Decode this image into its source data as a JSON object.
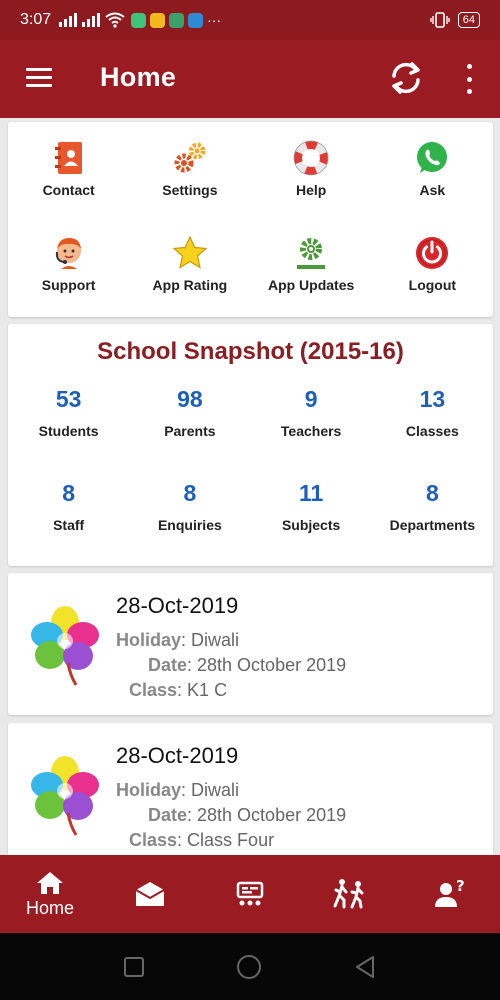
{
  "status_bar": {
    "time": "3:07",
    "battery": "64"
  },
  "app_bar": {
    "title": "Home"
  },
  "menu": {
    "items": [
      {
        "label": "Contact",
        "icon": "contact-book-icon"
      },
      {
        "label": "Settings",
        "icon": "gears-icon"
      },
      {
        "label": "Help",
        "icon": "lifebuoy-icon"
      },
      {
        "label": "Ask",
        "icon": "whatsapp-icon"
      },
      {
        "label": "Support",
        "icon": "support-agent-icon"
      },
      {
        "label": "App Rating",
        "icon": "star-icon"
      },
      {
        "label": "App Updates",
        "icon": "update-gear-icon"
      },
      {
        "label": "Logout",
        "icon": "power-icon"
      }
    ]
  },
  "snapshot": {
    "title": "School Snapshot (2015-16)",
    "stats": [
      {
        "value": "53",
        "label": "Students"
      },
      {
        "value": "98",
        "label": "Parents"
      },
      {
        "value": "9",
        "label": "Teachers"
      },
      {
        "value": "13",
        "label": "Classes"
      },
      {
        "value": "8",
        "label": "Staff"
      },
      {
        "value": "8",
        "label": "Enquiries"
      },
      {
        "value": "11",
        "label": "Subjects"
      },
      {
        "value": "8",
        "label": "Departments"
      }
    ]
  },
  "events": [
    {
      "date": "28-Oct-2019",
      "holiday_key": "Holiday",
      "holiday": ": Diwali",
      "date_key": "Date",
      "date_full": ": 28th October 2019",
      "class_key": "Class",
      "class_name": ": K1 C"
    },
    {
      "date": "28-Oct-2019",
      "holiday_key": "Holiday",
      "holiday": ": Diwali",
      "date_key": "Date",
      "date_full": ": 28th October 2019",
      "class_key": "Class",
      "class_name": ": Class Four"
    }
  ],
  "bottom_nav": {
    "home_label": "Home"
  },
  "colors": {
    "primary": "#9b1b22",
    "status": "#8d1a1f",
    "title": "#8a1e23",
    "stat_value": "#1e5fb8"
  }
}
